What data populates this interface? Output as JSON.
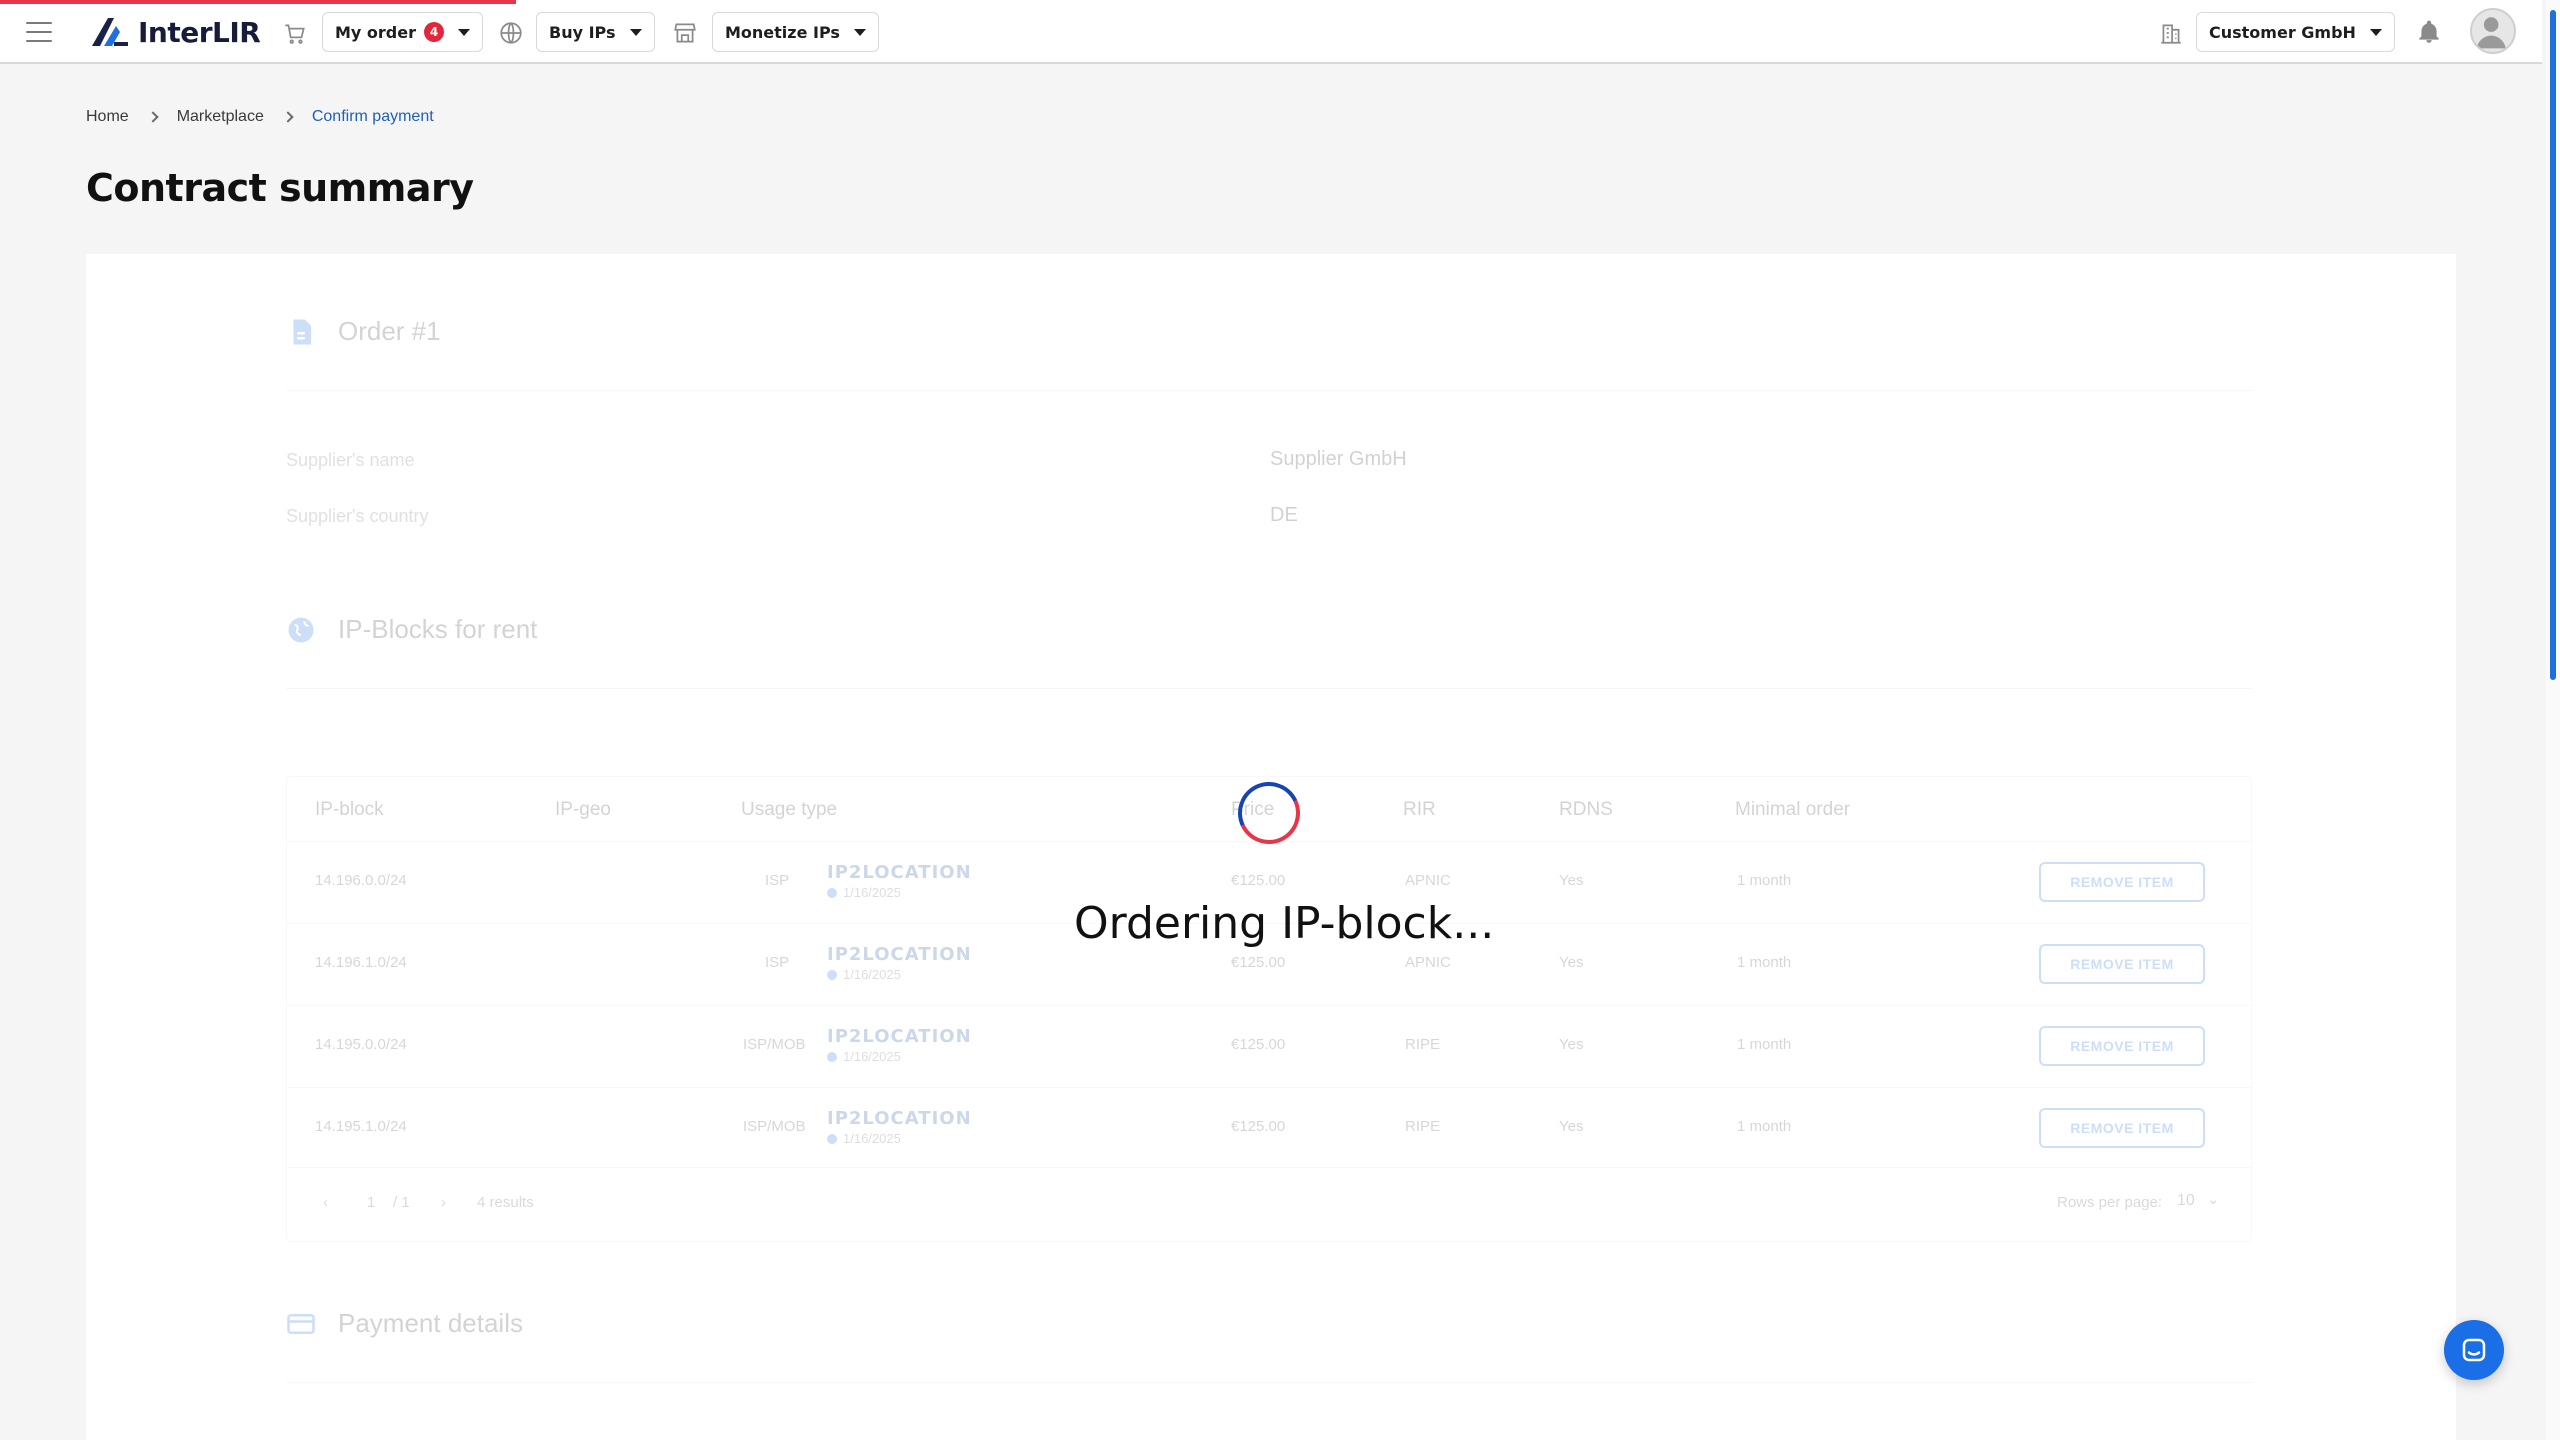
{
  "header": {
    "brand": "InterLIR",
    "my_order_label": "My order",
    "my_order_count": "4",
    "buy_ips_label": "Buy IPs",
    "monetize_ips_label": "Monetize IPs",
    "company_label": "Customer GmbH"
  },
  "breadcrumb": {
    "home": "Home",
    "marketplace": "Marketplace",
    "current": "Confirm payment"
  },
  "page_title": "Contract summary",
  "order_section": {
    "title": "Order #1",
    "supplier_name_label": "Supplier's name",
    "supplier_name_value": "Supplier GmbH",
    "supplier_country_label": "Supplier's country",
    "supplier_country_value": "DE"
  },
  "ipblocks_section": {
    "title": "IP-Blocks for rent",
    "columns": [
      "IP-block",
      "IP-geo",
      "Usage type",
      "Price",
      "RIR",
      "RDNS",
      "Minimal order"
    ],
    "rows": [
      {
        "ip_block": "14.196.0.0/24",
        "usage": "ISP",
        "geo_brand": "IP2LOCATION",
        "geo_date": "1/16/2025",
        "price": "€125.00",
        "rir": "APNIC",
        "rdns": "Yes",
        "minimal_order": "1 month",
        "action": "REMOVE ITEM"
      },
      {
        "ip_block": "14.196.1.0/24",
        "usage": "ISP",
        "geo_brand": "IP2LOCATION",
        "geo_date": "1/16/2025",
        "price": "€125.00",
        "rir": "APNIC",
        "rdns": "Yes",
        "minimal_order": "1 month",
        "action": "REMOVE ITEM"
      },
      {
        "ip_block": "14.195.0.0/24",
        "usage": "ISP/MOB",
        "geo_brand": "IP2LOCATION",
        "geo_date": "1/16/2025",
        "price": "€125.00",
        "rir": "RIPE",
        "rdns": "Yes",
        "minimal_order": "1 month",
        "action": "REMOVE ITEM"
      },
      {
        "ip_block": "14.195.1.0/24",
        "usage": "ISP/MOB",
        "geo_brand": "IP2LOCATION",
        "geo_date": "1/16/2025",
        "price": "€125.00",
        "rir": "RIPE",
        "rdns": "Yes",
        "minimal_order": "1 month",
        "action": "REMOVE ITEM"
      }
    ],
    "pagination": {
      "page": "1",
      "separator": "/ 1",
      "results": "4 results",
      "rows_per_page_label": "Rows per page:",
      "rows_per_page_value": "10"
    }
  },
  "payment_section": {
    "title": "Payment details"
  },
  "loading": {
    "text": "Ordering IP-block..."
  },
  "colors": {
    "accent": "#1e6fe0",
    "progress": "#e8354a",
    "badge": "#e2263b"
  }
}
